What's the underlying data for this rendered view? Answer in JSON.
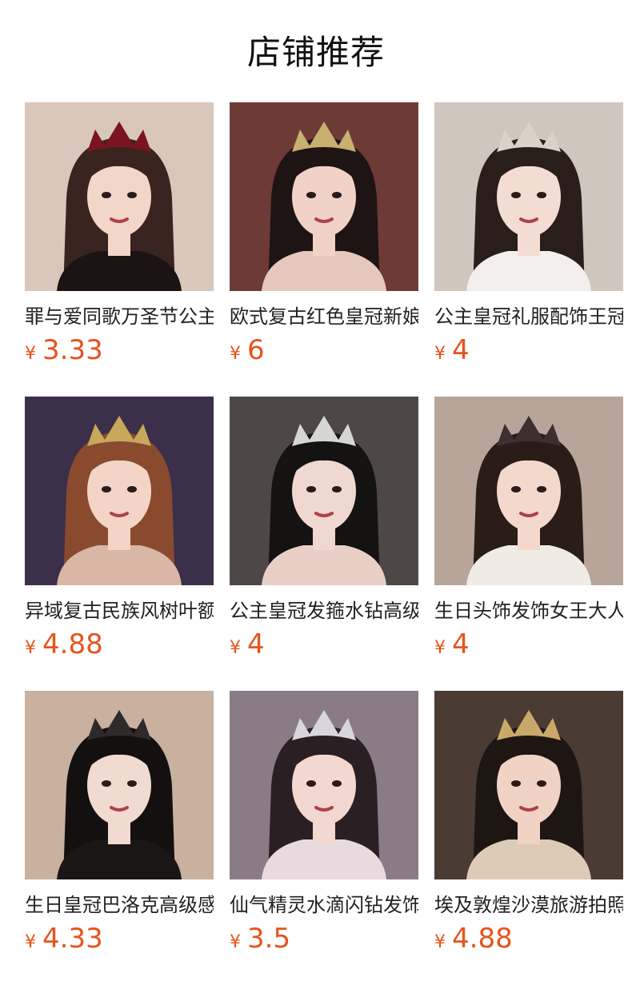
{
  "page_title": "店铺推荐",
  "currency_symbol": "¥",
  "accent_color": "#e8531c",
  "products": [
    {
      "name": "罪与爱同歌万圣节公主皇冠",
      "price": "3.33",
      "colors": {
        "bg": "#d9c7bb",
        "hair": "#3a2420",
        "skin": "#f2d6c8",
        "top": "#1c1414",
        "crown": "#7a1420"
      }
    },
    {
      "name": "欧式复古红色皇冠新娘头饰",
      "price": "6",
      "colors": {
        "bg": "#6e3a36",
        "hair": "#1e1414",
        "skin": "#f0d2c6",
        "top": "#e6c8bc",
        "crown": "#c8b070"
      }
    },
    {
      "name": "公主皇冠礼服配饰王冠",
      "price": "4",
      "colors": {
        "bg": "#cfc6bd",
        "hair": "#2a1e1a",
        "skin": "#f3ddd2",
        "top": "#f2efec",
        "crown": "#d8d2c8"
      }
    },
    {
      "name": "异域复古民族风树叶额饰",
      "price": "4.88",
      "colors": {
        "bg": "#3b2f4a",
        "hair": "#8a4a2e",
        "skin": "#f3d4c6",
        "top": "#d9b6a6",
        "crown": "#c8a85a"
      }
    },
    {
      "name": "公主皇冠发箍水钻高级感",
      "price": "4",
      "colors": {
        "bg": "#4d4846",
        "hair": "#151212",
        "skin": "#eed8cf",
        "top": "#e8d0c6",
        "crown": "#d6d6d2"
      }
    },
    {
      "name": "生日头饰发饰女王大人",
      "price": "4",
      "colors": {
        "bg": "#b7a59a",
        "hair": "#2a1d18",
        "skin": "#f2d9cc",
        "top": "#f1ebe6",
        "crown": "#3b3131"
      }
    },
    {
      "name": "生日皇冠巴洛克高级感",
      "price": "4.33",
      "colors": {
        "bg": "#c8b19e",
        "hair": "#141010",
        "skin": "#f1dad0",
        "top": "#1b1616",
        "crown": "#2e2a2a"
      }
    },
    {
      "name": "仙气精灵水滴闪钻发饰",
      "price": "3.5",
      "colors": {
        "bg": "#8a7c86",
        "hair": "#2a1f22",
        "skin": "#f1d8d0",
        "top": "#e7dbe0",
        "crown": "#d8d6dc"
      }
    },
    {
      "name": "埃及敦煌沙漠旅游拍照头饰",
      "price": "4.88",
      "colors": {
        "bg": "#4a3b33",
        "hair": "#1e1612",
        "skin": "#f0d3c4",
        "top": "#dccbb6",
        "crown": "#c9a96a"
      }
    }
  ]
}
